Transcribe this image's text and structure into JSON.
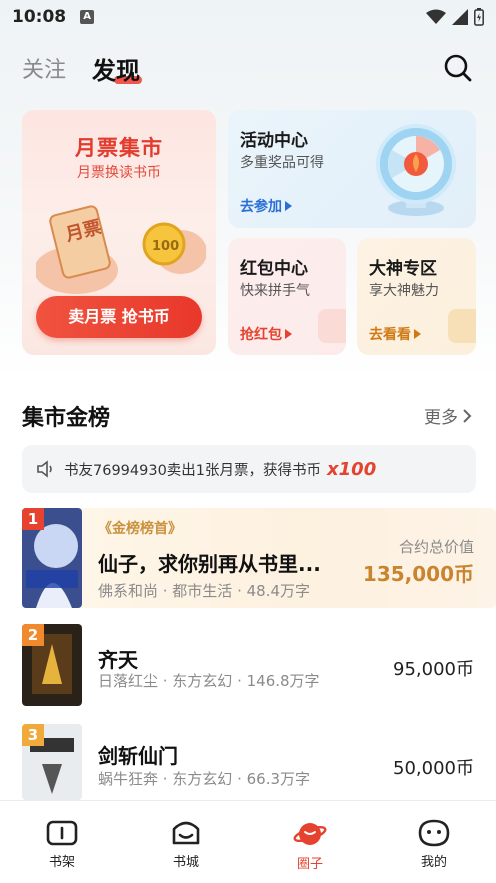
{
  "status": {
    "time": "10:08",
    "notif_icon": "A"
  },
  "header": {
    "tab_follow": "关注",
    "tab_discover": "发现"
  },
  "promo_left": {
    "title": "月票集市",
    "subtitle": "月票换读书币",
    "ticket_text": "月票",
    "coin_text": "100",
    "button": "卖月票 抢书币"
  },
  "activity": {
    "title": "活动中心",
    "subtitle": "多重奖品可得",
    "link": "去参加"
  },
  "red_packet": {
    "title": "红包中心",
    "subtitle": "快来拼手气",
    "link": "抢红包"
  },
  "god_zone": {
    "title": "大神专区",
    "subtitle": "享大神魅力",
    "link": "去看看"
  },
  "market": {
    "title": "集市金榜",
    "more": "更多"
  },
  "notice": {
    "text": "书友76994930卖出1张月票，获得书币",
    "multiplier": "x100"
  },
  "ranks": [
    {
      "rank": "1",
      "tag": "《金榜榜首》",
      "title": "仙子，求你别再从书里...",
      "meta": "佛系和尚 · 都市生活 · 48.4万字",
      "price_label": "合约总价值",
      "price": "135,000币"
    },
    {
      "rank": "2",
      "title": "齐天",
      "meta": "日落红尘 · 东方玄幻 · 146.8万字",
      "price": "95,000币"
    },
    {
      "rank": "3",
      "title": "剑斩仙门",
      "meta": "蜗牛狂奔 · 东方玄幻 · 66.3万字",
      "price": "50,000币"
    }
  ],
  "nav": [
    {
      "label": "书架",
      "icon": "bookshelf-icon"
    },
    {
      "label": "书城",
      "icon": "bookstore-icon"
    },
    {
      "label": "圈子",
      "icon": "planet-icon",
      "active": true
    },
    {
      "label": "我的",
      "icon": "profile-icon"
    }
  ],
  "colors": {
    "accent": "#e5432f",
    "gold": "#c9842e",
    "blue": "#2a6fd6"
  }
}
